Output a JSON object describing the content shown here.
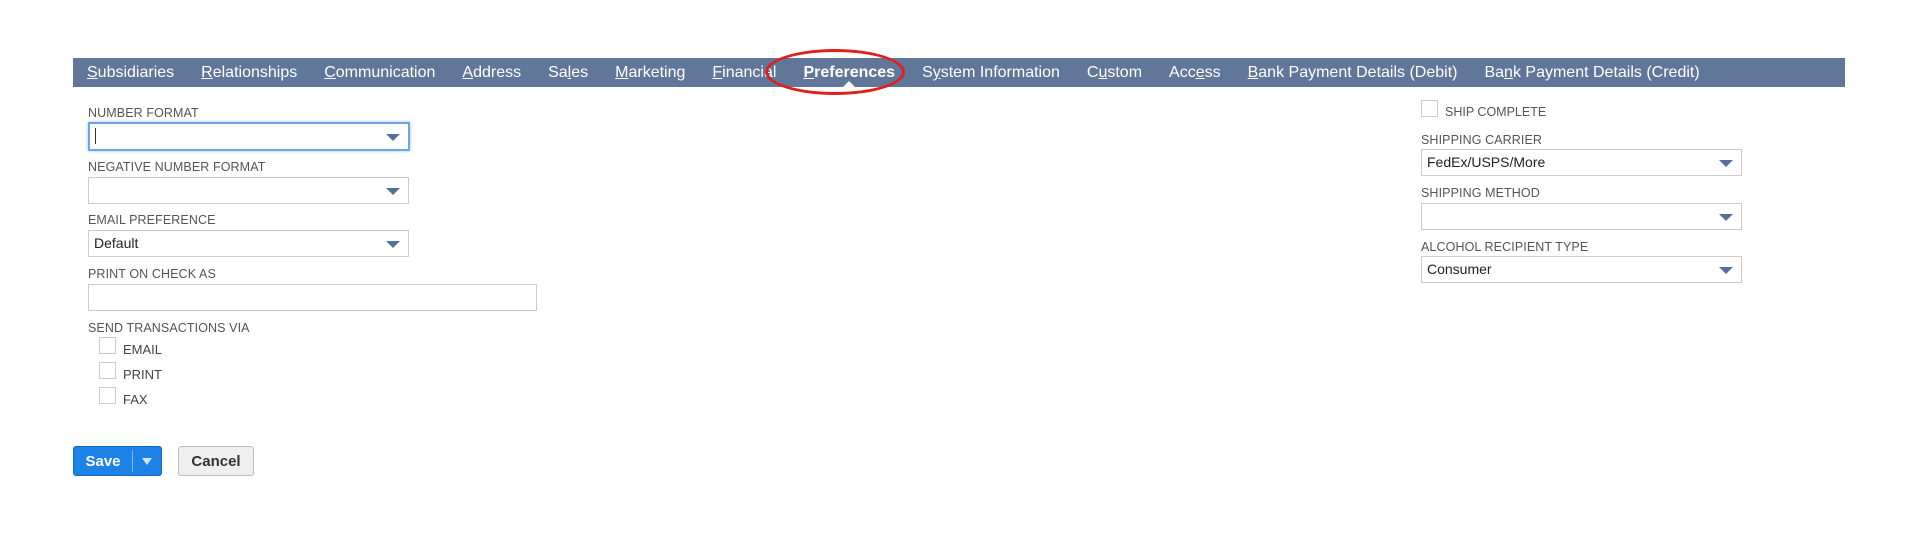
{
  "tabs": [
    {
      "pre": "",
      "u": "S",
      "post": "ubsidiaries",
      "active": false,
      "name": "subsidiaries"
    },
    {
      "pre": "",
      "u": "R",
      "post": "elationships",
      "active": false,
      "name": "relationships"
    },
    {
      "pre": "",
      "u": "C",
      "post": "ommunication",
      "active": false,
      "name": "communication"
    },
    {
      "pre": "",
      "u": "A",
      "post": "ddress",
      "active": false,
      "name": "address"
    },
    {
      "pre": "Sa",
      "u": "l",
      "post": "es",
      "active": false,
      "name": "sales"
    },
    {
      "pre": "",
      "u": "M",
      "post": "arketing",
      "active": false,
      "name": "marketing"
    },
    {
      "pre": "",
      "u": "F",
      "post": "inancial",
      "active": false,
      "name": "financial"
    },
    {
      "pre": "",
      "u": "P",
      "post": "references",
      "active": true,
      "name": "preferences"
    },
    {
      "pre": "S",
      "u": "y",
      "post": "stem Information",
      "active": false,
      "name": "system-information"
    },
    {
      "pre": "C",
      "u": "u",
      "post": "stom",
      "active": false,
      "name": "custom"
    },
    {
      "pre": "Acc",
      "u": "e",
      "post": "ss",
      "active": false,
      "name": "access"
    },
    {
      "pre": "",
      "u": "B",
      "post": "ank Payment Details (Debit)",
      "active": false,
      "name": "bank-payment-debit"
    },
    {
      "pre": "Ba",
      "u": "n",
      "post": "k Payment Details (Credit)",
      "active": false,
      "name": "bank-payment-credit"
    }
  ],
  "left": {
    "number_format": {
      "label": "NUMBER FORMAT",
      "value": ""
    },
    "negative_number_format": {
      "label": "NEGATIVE NUMBER FORMAT",
      "value": ""
    },
    "email_preference": {
      "label": "EMAIL PREFERENCE",
      "value": "Default"
    },
    "print_on_check_as": {
      "label": "PRINT ON CHECK AS",
      "value": ""
    },
    "send_transactions_via": {
      "label": "SEND TRANSACTIONS VIA",
      "options": [
        {
          "label": "EMAIL",
          "checked": false
        },
        {
          "label": "PRINT",
          "checked": false
        },
        {
          "label": "FAX",
          "checked": false
        }
      ]
    }
  },
  "right": {
    "ship_complete": {
      "label": "SHIP COMPLETE",
      "checked": false
    },
    "shipping_carrier": {
      "label": "SHIPPING CARRIER",
      "value": "FedEx/USPS/More"
    },
    "shipping_method": {
      "label": "SHIPPING METHOD",
      "value": ""
    },
    "alcohol_recipient_type": {
      "label": "ALCOHOL RECIPIENT TYPE",
      "value": "Consumer"
    }
  },
  "buttons": {
    "save": "Save",
    "cancel": "Cancel"
  },
  "colors": {
    "tabbar": "#607799",
    "accent": "#1d82e8",
    "highlight": "#e0201a"
  },
  "icons": {
    "dropdown": "caret-down-icon"
  }
}
